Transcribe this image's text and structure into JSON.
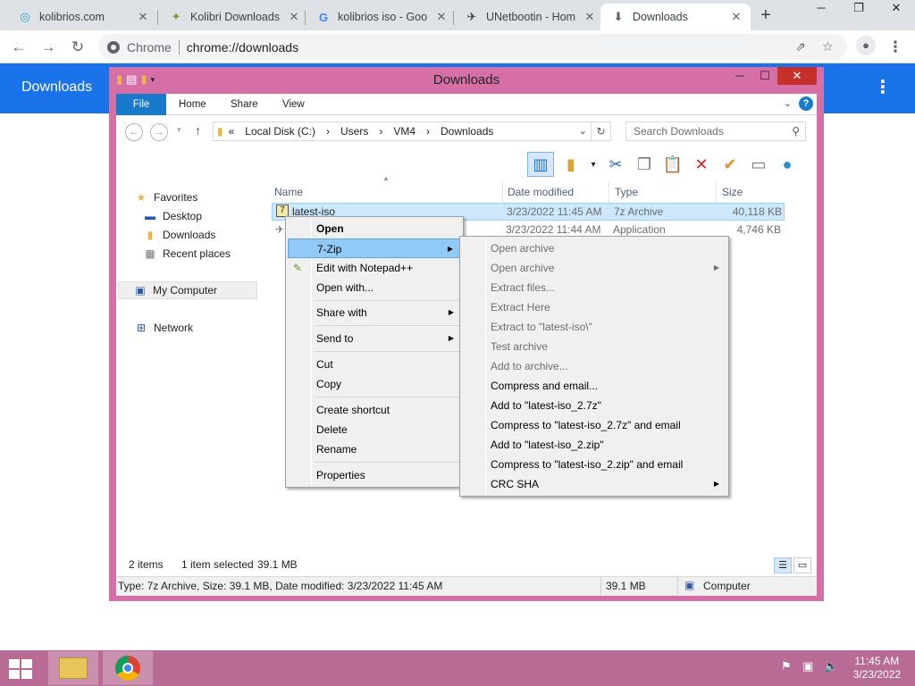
{
  "browser": {
    "tabs": [
      {
        "title": "kolibrios.com",
        "favicon": "kolibri-swirl-icon"
      },
      {
        "title": "Kolibri Downloads",
        "favicon": "kolibri-bird-icon"
      },
      {
        "title": "kolibrios iso - Goo",
        "favicon": "google-g-icon"
      },
      {
        "title": "UNetbootin - Hom",
        "favicon": "unetbootin-icon"
      },
      {
        "title": "Downloads",
        "favicon": "download-icon"
      }
    ],
    "omnibox": {
      "label": "Chrome",
      "url": "chrome://downloads"
    },
    "downloads_title": "Downloads"
  },
  "explorer": {
    "title": "Downloads",
    "ribbon_tabs": [
      "File",
      "Home",
      "Share",
      "View"
    ],
    "address": {
      "prefix": "«",
      "crumbs": [
        "Local Disk (C:)",
        "Users",
        "VM4",
        "Downloads"
      ]
    },
    "search_placeholder": "Search Downloads",
    "nav": {
      "favorites": "Favorites",
      "desktop": "Desktop",
      "downloads": "Downloads",
      "recent": "Recent places",
      "computer": "My Computer",
      "network": "Network"
    },
    "columns": {
      "name": "Name",
      "date": "Date modified",
      "type": "Type",
      "size": "Size"
    },
    "files": [
      {
        "name": "latest-iso",
        "date": "3/23/2022 11:45 AM",
        "type": "7z Archive",
        "size": "40,118 KB"
      },
      {
        "name": "",
        "date": "3/23/2022 11:44 AM",
        "type": "Application",
        "size": "4,746 KB"
      }
    ],
    "status": {
      "items": "2 items",
      "selected": "1 item selected",
      "sel_size": "39.1 MB"
    },
    "details": {
      "text": "Type: 7z Archive, Size: 39.1 MB, Date modified: 3/23/2022 11:45 AM",
      "size": "39.1 MB",
      "location": "Computer"
    }
  },
  "context_menu": {
    "open": "Open",
    "seven_zip": "7-Zip",
    "edit_npp": "Edit with Notepad++",
    "open_with": "Open with...",
    "share_with": "Share with",
    "send_to": "Send to",
    "cut": "Cut",
    "copy": "Copy",
    "create_shortcut": "Create shortcut",
    "delete": "Delete",
    "rename": "Rename",
    "properties": "Properties"
  },
  "submenu": {
    "items": [
      "Open archive",
      "Open archive",
      "Extract files...",
      "Extract Here",
      "Extract to \"latest-iso\\\"",
      "Test archive",
      "Add to archive...",
      "Compress and email...",
      "Add to \"latest-iso_2.7z\"",
      "Compress to \"latest-iso_2.7z\" and email",
      "Add to \"latest-iso_2.zip\"",
      "Compress to \"latest-iso_2.zip\" and email",
      "CRC SHA"
    ]
  },
  "taskbar": {
    "time": "11:45 AM",
    "date": "3/23/2022"
  },
  "colors": {
    "chrome_blue": "#1a73e8",
    "explorer_frame": "#d66fa5",
    "taskbar": "#b86c95",
    "selection": "#cce8ff",
    "menu_highlight": "#91c9f7"
  }
}
